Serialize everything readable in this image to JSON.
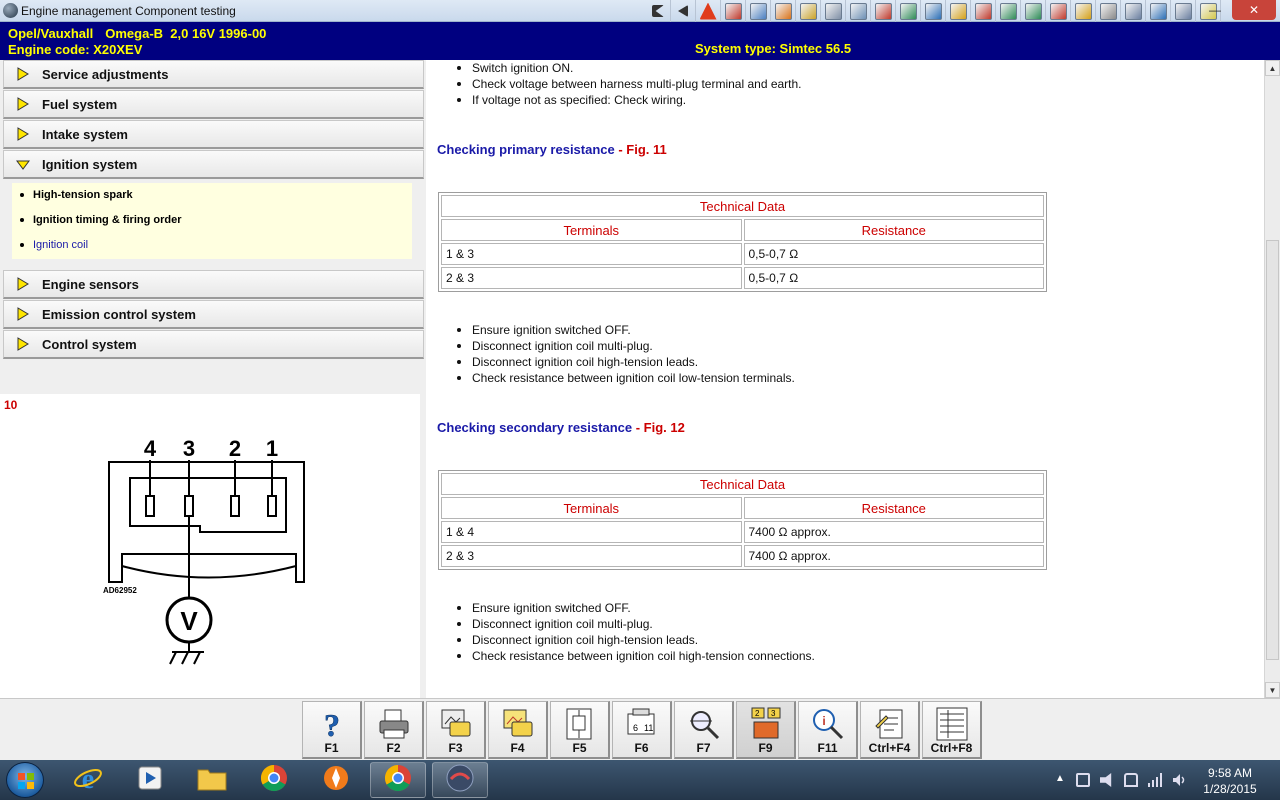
{
  "window": {
    "title": "Engine management Component testing",
    "controls": {
      "minimize": "—",
      "maximize": "□",
      "close": "✕"
    }
  },
  "toolbar": {
    "icons": [
      "first-icon",
      "back-icon",
      "warning-icon",
      "flag-icon",
      "display-icon",
      "gear-icon",
      "bug-icon",
      "gauge-icon",
      "engine-icon",
      "tools-icon",
      "door-icon",
      "person-icon",
      "wrench-icon",
      "timing-icon",
      "battery-icon",
      "list-icon",
      "fuel-icon",
      "vehicle-icon",
      "lift-icon",
      "tire-icon",
      "warning-light-icon",
      "car-icon",
      "note-icon"
    ]
  },
  "vehicle": {
    "make": "Opel/Vauxhall",
    "model": "Omega-B  2,0 16V 1996-00",
    "engine_code": "Engine code: X20XEV",
    "system_type": "System type: Simtec 56.5"
  },
  "nav": {
    "items": [
      {
        "label": "Service adjustments",
        "expanded": false
      },
      {
        "label": "Fuel system",
        "expanded": false
      },
      {
        "label": "Intake system",
        "expanded": false
      },
      {
        "label": "Ignition system",
        "expanded": true
      },
      {
        "label": "Engine sensors",
        "expanded": false
      },
      {
        "label": "Emission control system",
        "expanded": false
      },
      {
        "label": "Control system",
        "expanded": false
      }
    ],
    "subitems": [
      {
        "label": "High-tension spark",
        "active": false
      },
      {
        "label": "Ignition timing & firing order",
        "active": false
      },
      {
        "label": "Ignition coil",
        "active": true
      }
    ]
  },
  "figure": {
    "number": "10",
    "terminals": [
      "4",
      "3",
      "2",
      "1"
    ],
    "code": "AD62952",
    "meter": "V"
  },
  "content": {
    "top_bullets": [
      "Switch ignition ON.",
      "Check voltage between harness multi-plug terminal and earth.",
      "If voltage not as specified: Check wiring."
    ],
    "sections": [
      {
        "heading": "Checking primary resistance",
        "fig_ref": " - Fig. 11",
        "table": {
          "title": "Technical Data",
          "col_terminals": "Terminals",
          "col_resistance": "Resistance",
          "rows": [
            {
              "terminals": "1 & 3",
              "resistance": "0,5-0,7 Ω"
            },
            {
              "terminals": "2 & 3",
              "resistance": "0,5-0,7 Ω"
            }
          ]
        },
        "bullets": [
          "Ensure ignition switched OFF.",
          "Disconnect ignition coil multi-plug.",
          "Disconnect ignition coil high-tension leads.",
          "Check resistance between ignition coil low-tension terminals."
        ]
      },
      {
        "heading": "Checking secondary resistance",
        "fig_ref": " - Fig. 12",
        "table": {
          "title": "Technical Data",
          "col_terminals": "Terminals",
          "col_resistance": "Resistance",
          "rows": [
            {
              "terminals": "1 & 4",
              "resistance": "7400 Ω approx."
            },
            {
              "terminals": "2 & 3",
              "resistance": "7400 Ω approx."
            }
          ]
        },
        "bullets": [
          "Ensure ignition switched OFF.",
          "Disconnect ignition coil multi-plug.",
          "Disconnect ignition coil high-tension leads.",
          "Check resistance between ignition coil high-tension connections."
        ]
      }
    ]
  },
  "fkeys": [
    {
      "label": "F1",
      "icon": "help-icon"
    },
    {
      "label": "F2",
      "icon": "print-icon"
    },
    {
      "label": "F3",
      "icon": "image-print-icon"
    },
    {
      "label": "F4",
      "icon": "image-print-color-icon"
    },
    {
      "label": "F5",
      "icon": "diagram-icon"
    },
    {
      "label": "F6",
      "icon": "component-icon"
    },
    {
      "label": "F7",
      "icon": "search-icon"
    },
    {
      "label": "F9",
      "icon": "display-mode-icon"
    },
    {
      "label": "F11",
      "icon": "zoom-info-icon"
    },
    {
      "label": "Ctrl+F4",
      "icon": "note-icon"
    },
    {
      "label": "Ctrl+F8",
      "icon": "list-icon"
    }
  ],
  "taskbar": {
    "apps": [
      "ie-icon",
      "media-icon",
      "explorer-icon",
      "chrome-icon",
      "avast-icon",
      "chrome-icon",
      "app-icon"
    ],
    "time": "9:58 AM",
    "date": "1/28/2015"
  }
}
